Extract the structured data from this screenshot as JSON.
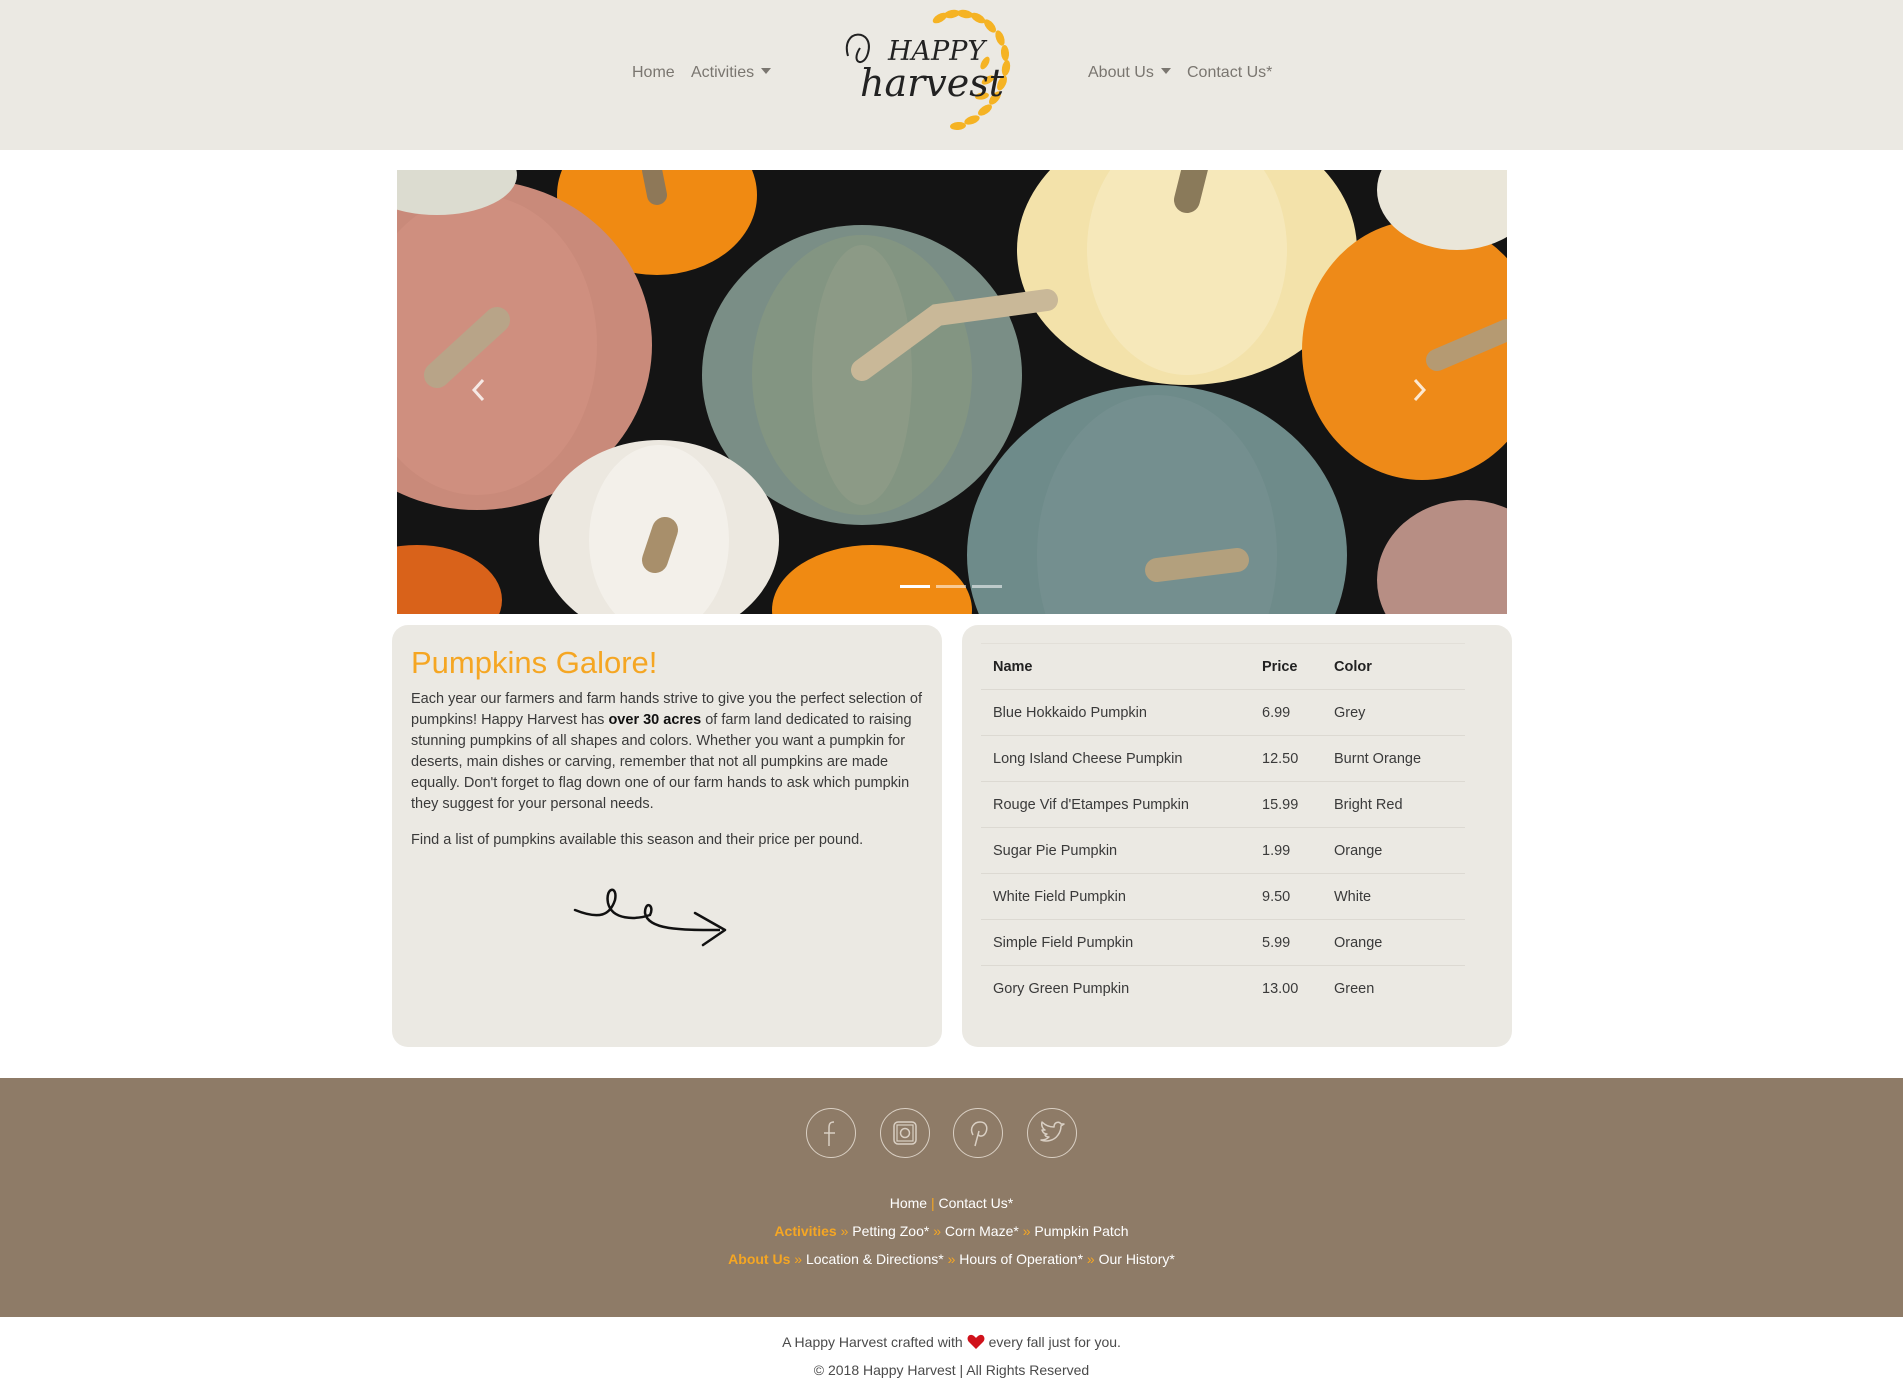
{
  "colors": {
    "header_bg": "#ebe9e3",
    "accent": "#f5a623",
    "footer_bg": "#8e7b67",
    "card_bg": "#ebe9e3"
  },
  "nav": {
    "home": "Home",
    "activities": "Activities",
    "about": "About Us",
    "contact": "Contact Us*"
  },
  "logo": {
    "line1": "HAPPY",
    "line2": "harvest"
  },
  "carousel": {
    "slide_count": 3,
    "active_slide": 1,
    "prev_icon": "chevron-left-icon",
    "next_icon": "chevron-right-icon"
  },
  "intro": {
    "title": "Pumpkins Galore!",
    "para1_before": "Each year our farmers and farm hands strive to give you the perfect selection of pumpkins! Happy Harvest has ",
    "para1_bold": "over 30 acres",
    "para1_after": " of farm land dedicated to raising stunning pumpkins of all shapes and colors. Whether you want a pumpkin for deserts, main dishes or carving, remember that not all pumpkins are made equally. Don't forget to flag down one of our farm hands to ask which pumpkin they suggest for your personal needs.",
    "para2": "Find a list of pumpkins available this season and their price per pound."
  },
  "table": {
    "headers": [
      "Name",
      "Price",
      "Color"
    ],
    "rows": [
      [
        "Blue Hokkaido Pumpkin",
        "6.99",
        "Grey"
      ],
      [
        "Long Island Cheese Pumpkin",
        "12.50",
        "Burnt Orange"
      ],
      [
        "Rouge Vif d'Etampes Pumpkin",
        "15.99",
        "Bright Red"
      ],
      [
        "Sugar Pie Pumpkin",
        "1.99",
        "Orange"
      ],
      [
        "White Field Pumpkin",
        "9.50",
        "White"
      ],
      [
        "Simple Field Pumpkin",
        "5.99",
        "Orange"
      ],
      [
        "Gory Green Pumpkin",
        "13.00",
        "Green"
      ]
    ]
  },
  "footer": {
    "social": [
      "facebook-icon",
      "instagram-icon",
      "pinterest-icon",
      "twitter-icon"
    ],
    "row1": {
      "home": "Home",
      "sep": "|",
      "contact": "Contact Us*"
    },
    "row2": {
      "label": "Activities",
      "arrow": "»",
      "petting": "Petting Zoo*",
      "maze": "Corn Maze*",
      "patch": "Pumpkin Patch"
    },
    "row3": {
      "label": "About Us",
      "arrow": "»",
      "location": "Location & Directions*",
      "hours": "Hours of Operation*",
      "history": "Our History*"
    }
  },
  "bottom": {
    "crafted_before": "A Happy Harvest crafted with",
    "crafted_after": "every fall just for you.",
    "copyright": "© 2018 Happy Harvest | All Rights Reserved"
  }
}
